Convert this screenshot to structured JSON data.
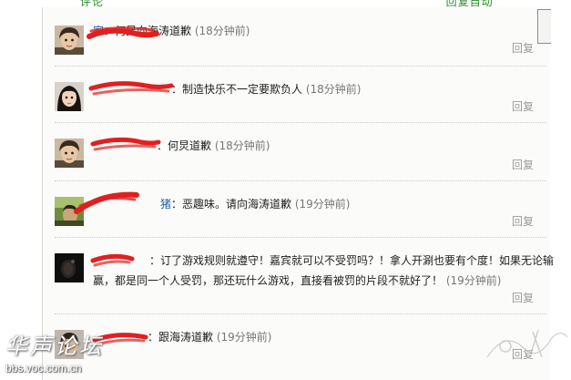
{
  "top_bar": {
    "text_a": "评论",
    "text_b": "回复自动"
  },
  "comments": [
    {
      "avatar": "avatar-boy-1",
      "username_visible": "家",
      "text": "：何炅向海涛道歉",
      "time": "(18分钟前)",
      "reply": "回复"
    },
    {
      "avatar": "avatar-girl",
      "username_visible": "",
      "text": "：制造快乐不一定要欺负人",
      "time": "(18分钟前)",
      "reply": "回复"
    },
    {
      "avatar": "avatar-boy-1",
      "username_visible": "",
      "text": "：何炅道歉",
      "time": "(18分钟前)",
      "reply": "回复"
    },
    {
      "avatar": "avatar-green",
      "username_visible": "猪",
      "text": "：恶趣味。请向海涛道歉",
      "time": "(19分钟前)",
      "reply": "回复"
    },
    {
      "avatar": "avatar-dark",
      "username_visible": "",
      "text_line1": "：订了游戏规则就遵守！嘉宾就可以不受罚吗？！拿人开涮也要有个度！如果无论输",
      "text_line2": "赢，都是同一个人受罚，那还玩什么游戏，直接看被罚的片段不就好了！",
      "time": "(19分钟前)",
      "reply": "回复"
    },
    {
      "avatar": "avatar-boy-2",
      "username_visible": "",
      "text": "：跟海涛道歉",
      "time": "(19分钟前)",
      "reply": "回复"
    }
  ],
  "watermark": {
    "title": "华声论坛",
    "url": "bbs.voc.com.cn"
  },
  "colors": {
    "redaction": "#e02020",
    "username": "#1f5fa8",
    "reply": "#9a9a9a",
    "panel": "#fbfbf9"
  }
}
